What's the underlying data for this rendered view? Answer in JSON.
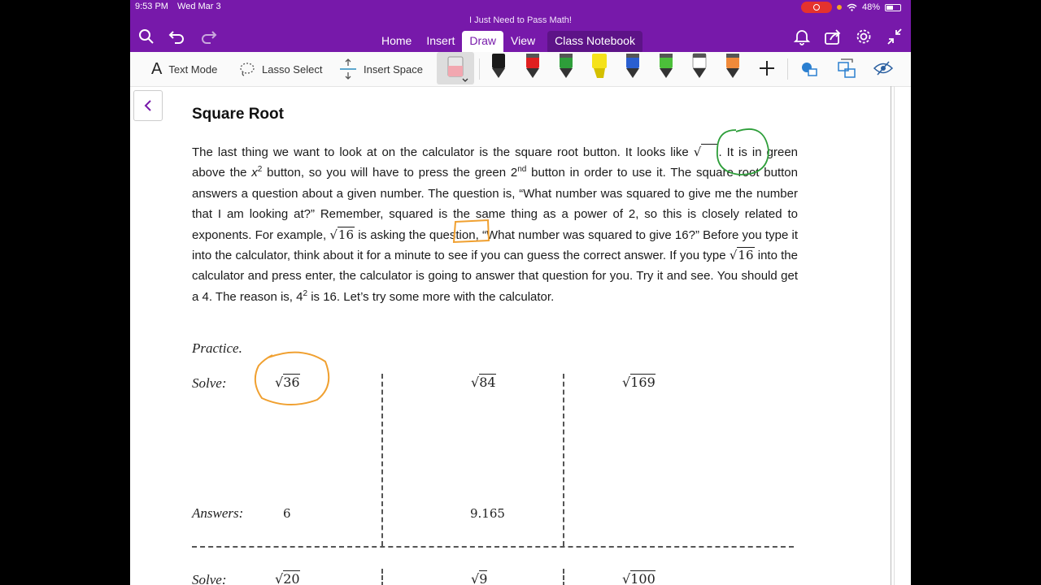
{
  "status": {
    "time": "9:53 PM",
    "date": "Wed Mar 3",
    "battery": "48%"
  },
  "app": {
    "notebook_title": "I Just Need to Pass Math!"
  },
  "tabs": [
    {
      "label": "Home"
    },
    {
      "label": "Insert"
    },
    {
      "label": "Draw"
    },
    {
      "label": "View"
    },
    {
      "label": "Class Notebook"
    }
  ],
  "toolbar": {
    "text_mode": "Text Mode",
    "lasso_select": "Lasso Select",
    "insert_space": "Insert Space",
    "pens": [
      {
        "name": "black-pen",
        "color": "#1a1a1a"
      },
      {
        "name": "red-pen",
        "color": "#e02020"
      },
      {
        "name": "green-pen",
        "color": "#2e9e3a"
      },
      {
        "name": "yellow-highlighter",
        "color": "#f5e21a"
      },
      {
        "name": "blue-pen",
        "color": "#2a5fd0"
      },
      {
        "name": "lime-pen",
        "color": "#4cbf3a"
      },
      {
        "name": "white-pen",
        "color": "#ffffff"
      },
      {
        "name": "orange-pen",
        "color": "#f08a3a"
      }
    ]
  },
  "page": {
    "title": "Square Root",
    "para": {
      "t1": "The last thing we want to look at on the calculator is the square root button. It looks like ",
      "t2": ". It is in green above the ",
      "x": "x",
      "sup2": "2",
      "t3": " button, so you will have to press the green 2",
      "nd": "nd",
      "t4": " button in order to use it. The square root button answers a question about a given number. The question is, “What number was squared to give me the number that I am looking at?” Remember, squared is the same thing as a power of 2, so this is closely related to exponents. For example, ",
      "root16": "16",
      "t5": " is asking the question, “What number was squared to give 16?” Before you type it into the calculator, think about it for a minute to see if you can guess the correct answer. If you type ",
      "t6": " into the calculator and press enter, the calculator is going to answer that question for you. Try it and see. You should get a 4. The reason is, 4",
      "t7": " is 16. Let’s try some more with the calculator."
    },
    "practice_label": "Practice.",
    "solve_label": "Solve:",
    "answers_label": "Answers:",
    "problems_row1": [
      "36",
      "84",
      "169"
    ],
    "answers_row1": [
      "6",
      "9.165"
    ],
    "problems_row2": [
      "20",
      "9",
      "100"
    ]
  },
  "ink_colors": {
    "green": "#2e9e3a",
    "orange": "#f0a030"
  }
}
